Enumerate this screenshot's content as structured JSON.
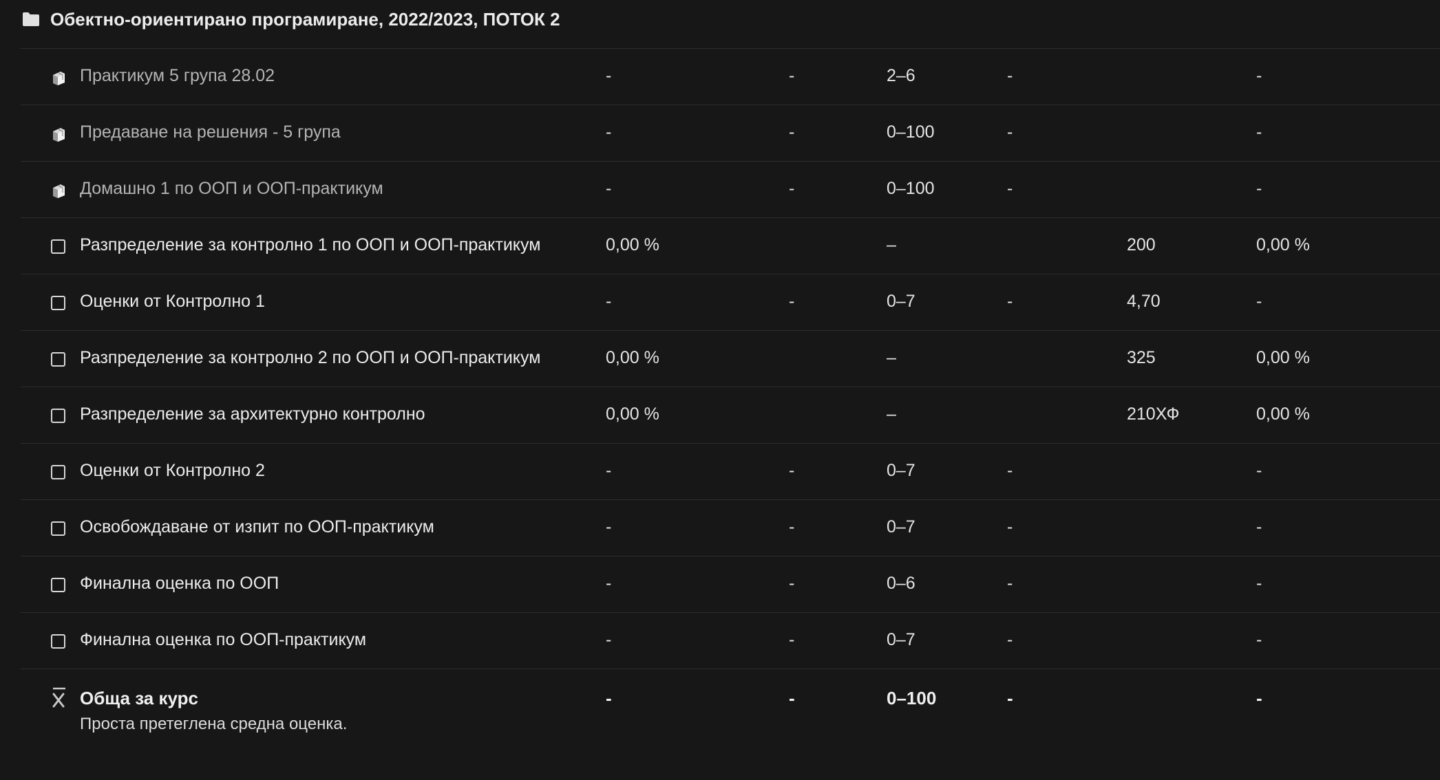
{
  "category": {
    "icon": "folder-icon",
    "title": "Обектно-ориентирано програмиране, 2022/2023, ПОТОК 2"
  },
  "rows": [
    {
      "type": "assign",
      "icon": "assignment-icon",
      "name": "Практикум 5 група 28.02",
      "weight": "-",
      "grade": "-",
      "range": "2–6",
      "percent": "-",
      "feedback": "",
      "contribution": "-"
    },
    {
      "type": "assign",
      "icon": "assignment-icon",
      "name": "Предаване на решения - 5 група",
      "weight": "-",
      "grade": "-",
      "range": "0–100",
      "percent": "-",
      "feedback": "",
      "contribution": "-"
    },
    {
      "type": "assign",
      "icon": "assignment-icon",
      "name": "Домашно 1 по ООП и ООП-практикум",
      "weight": "-",
      "grade": "-",
      "range": "0–100",
      "percent": "-",
      "feedback": "",
      "contribution": "-"
    },
    {
      "type": "manual",
      "icon": "manual-item-icon",
      "name": "Разпределение за контролно 1 по ООП и ООП-практикум",
      "weight": "0,00 %",
      "grade": "",
      "range": "–",
      "percent": "",
      "feedback": "200",
      "contribution": "0,00 %"
    },
    {
      "type": "manual",
      "icon": "manual-item-icon",
      "name": "Оценки от Контролно 1",
      "weight": "-",
      "grade": "-",
      "range": "0–7",
      "percent": "-",
      "feedback": "4,70",
      "contribution": "-"
    },
    {
      "type": "manual",
      "icon": "manual-item-icon",
      "name": "Разпределение за контролно 2 по ООП и ООП-практикум",
      "weight": "0,00 %",
      "grade": "",
      "range": "–",
      "percent": "",
      "feedback": "325",
      "contribution": "0,00 %"
    },
    {
      "type": "manual",
      "icon": "manual-item-icon",
      "name": "Разпределение за архитектурно контролно",
      "weight": "0,00 %",
      "grade": "",
      "range": "–",
      "percent": "",
      "feedback": "210ХФ",
      "contribution": "0,00 %"
    },
    {
      "type": "manual",
      "icon": "manual-item-icon",
      "name": "Оценки от Контролно 2",
      "weight": "-",
      "grade": "-",
      "range": "0–7",
      "percent": "-",
      "feedback": "",
      "contribution": "-"
    },
    {
      "type": "manual",
      "icon": "manual-item-icon",
      "name": "Освобождаване от изпит по ООП-практикум",
      "weight": "-",
      "grade": "-",
      "range": "0–7",
      "percent": "-",
      "feedback": "",
      "contribution": "-"
    },
    {
      "type": "manual",
      "icon": "manual-item-icon",
      "name": "Финална оценка по ООП",
      "weight": "-",
      "grade": "-",
      "range": "0–6",
      "percent": "-",
      "feedback": "",
      "contribution": "-"
    },
    {
      "type": "manual",
      "icon": "manual-item-icon",
      "name": "Финална оценка по ООП-практикум",
      "weight": "-",
      "grade": "-",
      "range": "0–7",
      "percent": "-",
      "feedback": "",
      "contribution": "-"
    }
  ],
  "total": {
    "icon": "aggregation-icon",
    "name": "Обща за курс",
    "description": "Проста претеглена средна оценка.",
    "weight": "-",
    "grade": "-",
    "range": "0–100",
    "percent": "-",
    "contribution": "-"
  }
}
